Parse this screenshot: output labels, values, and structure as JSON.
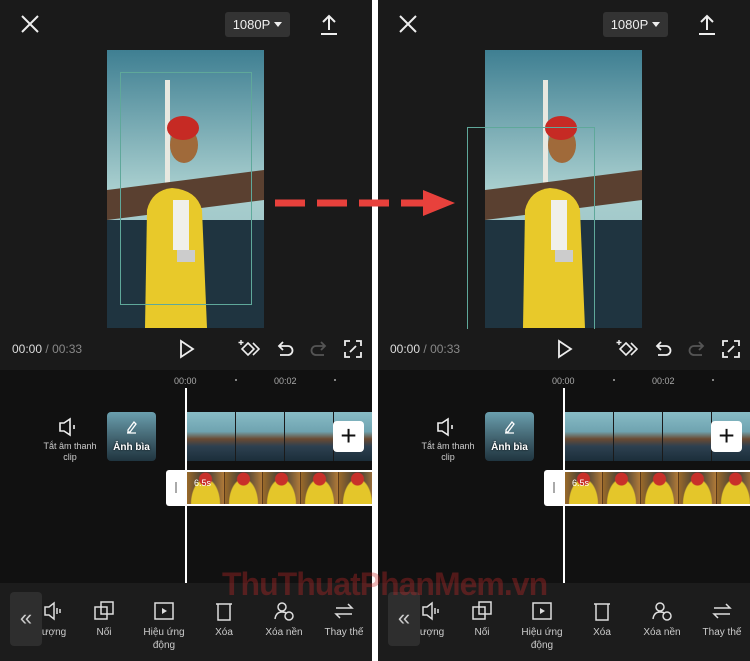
{
  "editor": {
    "resolution": "1080P",
    "current_time": "00:00",
    "separator": "/",
    "total_time": "00:33",
    "ruler": [
      "00:00",
      "00:02"
    ],
    "mute_label": "Tắt âm thanh clip",
    "cover_label": "Ảnh bìa",
    "add_label": "+",
    "clip_duration": "6.5s",
    "collapse_label": "«",
    "tools": [
      {
        "icon": "volume-icon",
        "label": "ượng"
      },
      {
        "icon": "overlay-icon",
        "label": "Nối"
      },
      {
        "icon": "animation-icon",
        "label": "Hiệu ứng động"
      },
      {
        "icon": "trash-icon",
        "label": "Xóa"
      },
      {
        "icon": "remove-background-icon",
        "label": "Xóa nền"
      },
      {
        "icon": "replace-icon",
        "label": "Thay thế"
      }
    ]
  },
  "watermark": "ThuThuatPhanMem.vn",
  "colors": {
    "arrow": "#e8413c",
    "frame": "#5fa89a"
  }
}
